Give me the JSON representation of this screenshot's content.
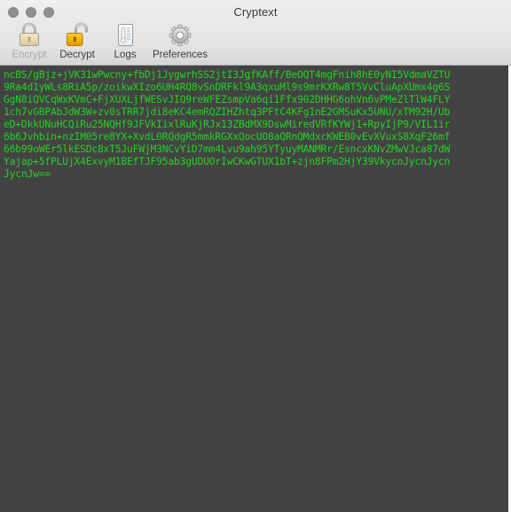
{
  "window": {
    "title": "Cryptext",
    "controls": [
      {
        "name": "close",
        "color": "#8e8e93"
      },
      {
        "name": "minimize",
        "color": "#8e8e93"
      },
      {
        "name": "zoom",
        "color": "#8e8e93"
      }
    ]
  },
  "toolbar": {
    "items": [
      {
        "id": "encrypt",
        "label": "Encrypt",
        "icon": "closed-padlock-icon",
        "enabled": false
      },
      {
        "id": "decrypt",
        "label": "Decrypt",
        "icon": "open-padlock-icon",
        "enabled": true
      },
      {
        "id": "logs",
        "label": "Logs",
        "icon": "document-log-icon",
        "enabled": true
      },
      {
        "id": "preferences",
        "label": "Preferences",
        "icon": "gear-icon",
        "enabled": true
      }
    ]
  },
  "editor": {
    "text_color": "#21d421",
    "background_color": "#434343",
    "lines": [
      "ncBS/gBjz+jVK31wPwcny+fbDj1JygwrhSS2jtI3JgfKAff/BeOQT4mgFnih8hE0yNI5VdmaVZTU",
      "9Ra4d1yWLs8RiA5p/zoikwXIzo6UH4RQ8vSnDRFkl9A3qxuMl9s9mrKXRw8T5VvCluApXUmx4g6S",
      "GgN8iQVCqWxKVmC+FjXUXLjfWESvJIQ9reWFEZsmpVa6qi1Ffx902DHHG6ohVn6vPMeZlTlW4FLY",
      "1ch7vGBPAbJdW3W+zv0sTRR7jdi8eKC4emRQZIHZhtq3PFtC4KFg1nE2GMSuKx5UNU/xTM92H/Ub",
      "eD+DkkUNuHCQiRu25NQHf9JFVkIixlRuKjRJx13ZBdMX9DswMiredVRfKYWj1+RpyIjP9/VIL1ir",
      "6b6Jvhbin+nzIM05re8YX+XvdL0RQdgR5mmkRGXxQocUO8aQRnQMdxcKWEB0vEvXVuxS8XqF26mf",
      "66b99oWEr5lkESDc8xT5JuFWjM3NCvYiD7mm4Lvu9ah95YTyuyMANMRr/EsncxKNvZMwVJca87dW",
      "Yajap+5fPLUjX4ExvyM1BEfTJF95ab3gUDUOrIwCKwGTUX1bT+zjn8FPm2HjY39VkycnJycnJycn",
      "JycnJw=="
    ]
  }
}
